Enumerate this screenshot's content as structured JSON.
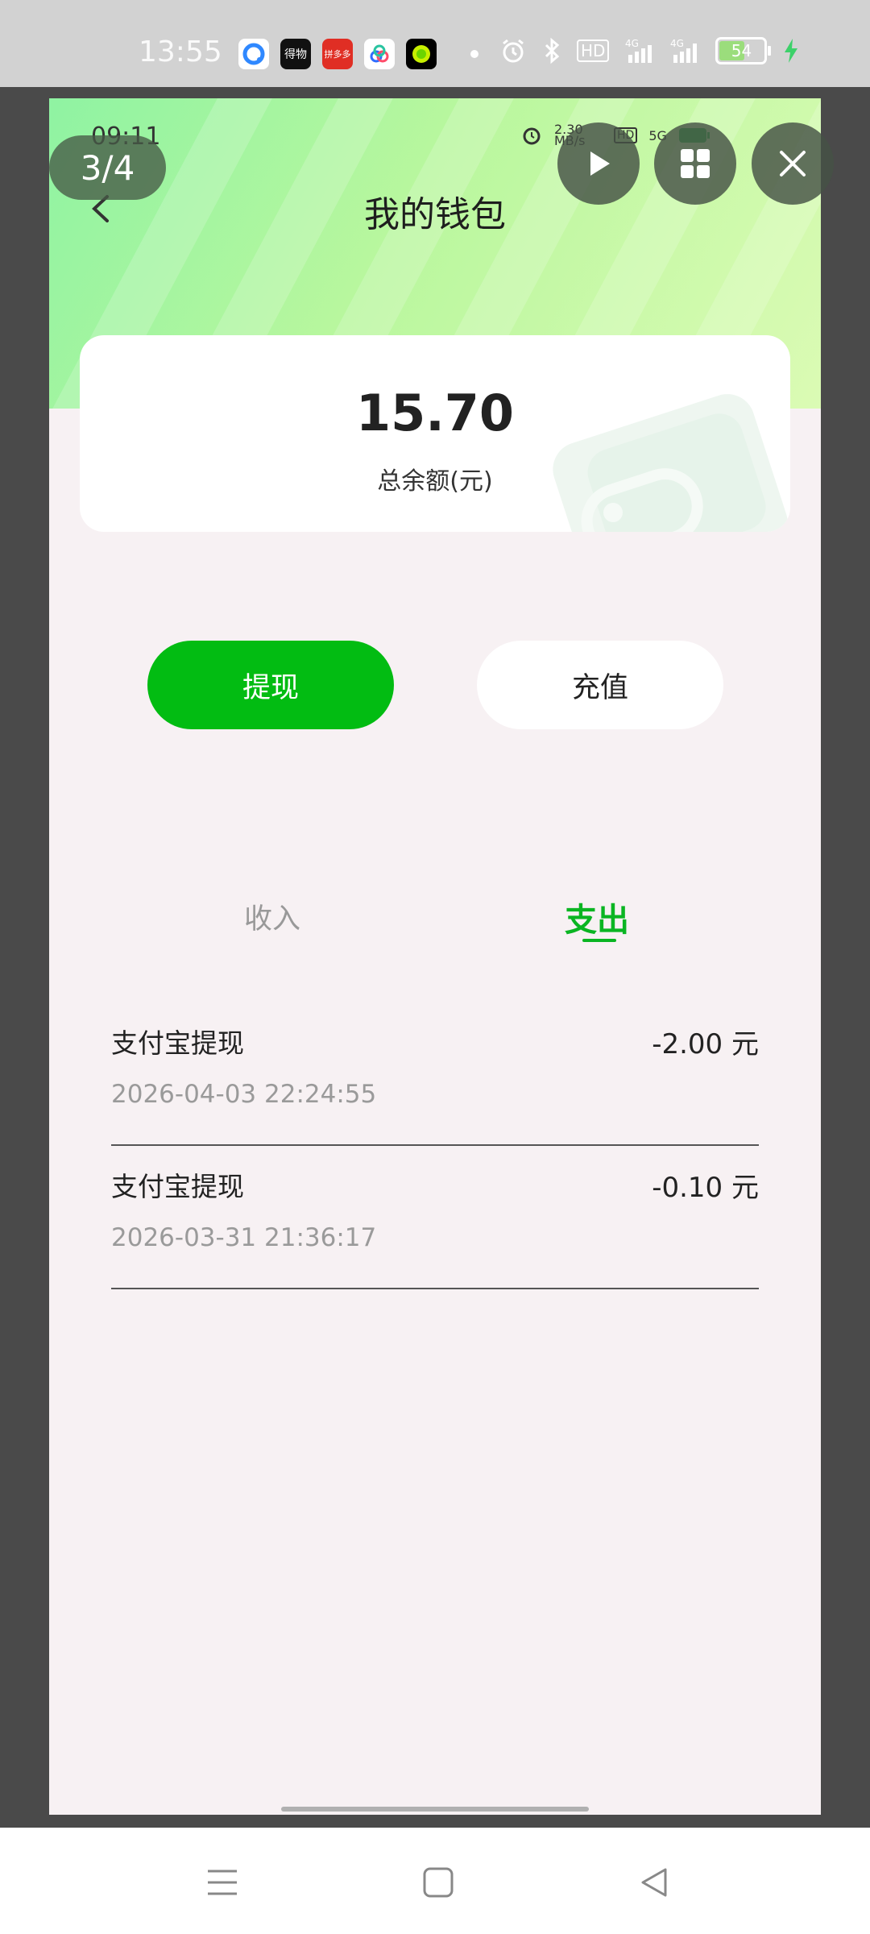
{
  "system_status": {
    "time": "13:55",
    "apps": [
      {
        "name": "browser-app-icon",
        "color": "#2f88ff",
        "label": ""
      },
      {
        "name": "dewu-app-icon",
        "color": "#111111",
        "label": "得物"
      },
      {
        "name": "pinduoduo-app-icon",
        "color": "#e02e24",
        "label": "拼多多"
      },
      {
        "name": "baidu-netdisk-app-icon",
        "color": "#ffffff",
        "label": ""
      },
      {
        "name": "green-ball-app-icon",
        "color": "#000000",
        "label": ""
      }
    ],
    "battery": "54",
    "network": "4G",
    "hd_label": "HD"
  },
  "screenshot": {
    "inner_time": "09:11",
    "inner_speed": "2.30 MB/s",
    "inner_network": "5G",
    "page_title": "我的钱包",
    "balance": {
      "amount": "15.70",
      "label": "总余额(元)"
    },
    "buttons": {
      "withdraw": "提现",
      "recharge": "充值"
    },
    "tabs": {
      "income": "收入",
      "expense": "支出",
      "active": "expense"
    },
    "records": [
      {
        "title": "支付宝提现",
        "amount": "-2.00 元",
        "time": "2026-04-03 22:24:55"
      },
      {
        "title": "支付宝提现",
        "amount": "-0.10 元",
        "time": "2026-03-31 21:36:17"
      }
    ],
    "colors": {
      "accent": "#02bc12",
      "tab_active": "#0ab522"
    }
  },
  "viewer": {
    "counter": "3/4"
  }
}
